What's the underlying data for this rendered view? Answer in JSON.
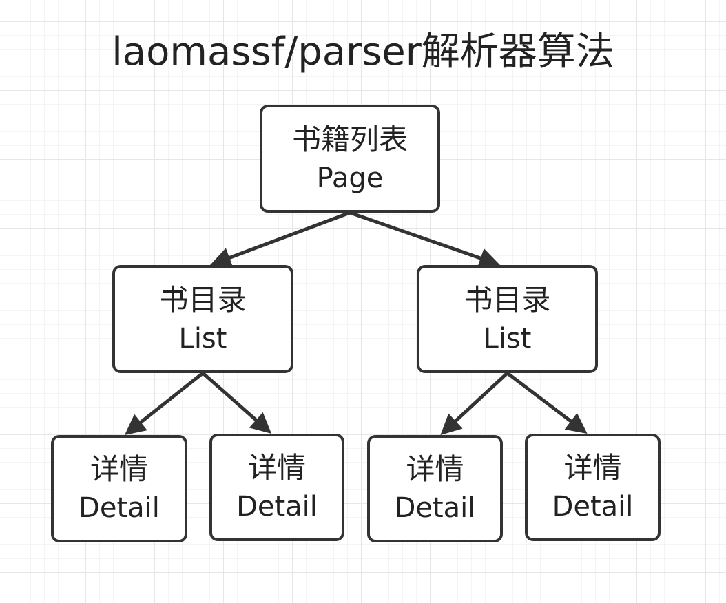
{
  "title": "laomassf/parser解析器算法",
  "colors": {
    "stroke": "#333333",
    "text": "#222222",
    "grid": "#e6e6e6",
    "background": "#ffffff"
  },
  "nodes": {
    "page": {
      "line1": "书籍列表",
      "line2": "Page"
    },
    "list_left": {
      "line1": "书目录",
      "line2": "List"
    },
    "list_right": {
      "line1": "书目录",
      "line2": "List"
    },
    "detail_1": {
      "line1": "详情",
      "line2": "Detail"
    },
    "detail_2": {
      "line1": "详情",
      "line2": "Detail"
    },
    "detail_3": {
      "line1": "详情",
      "line2": "Detail"
    },
    "detail_4": {
      "line1": "详情",
      "line2": "Detail"
    }
  },
  "edges": [
    {
      "from": "page",
      "to": "list_left"
    },
    {
      "from": "page",
      "to": "list_right"
    },
    {
      "from": "list_left",
      "to": "detail_1"
    },
    {
      "from": "list_left",
      "to": "detail_2"
    },
    {
      "from": "list_right",
      "to": "detail_3"
    },
    {
      "from": "list_right",
      "to": "detail_4"
    }
  ]
}
